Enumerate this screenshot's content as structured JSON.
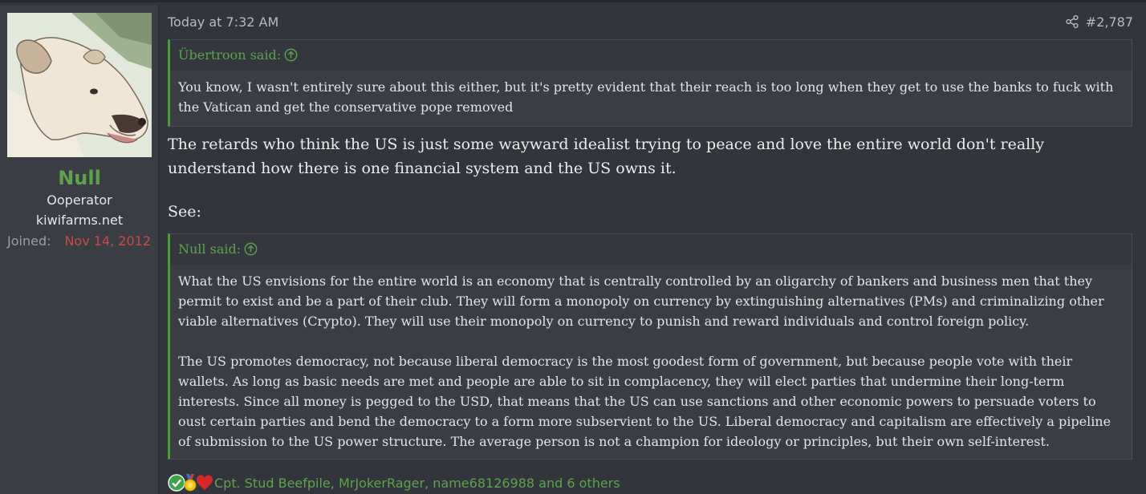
{
  "author": {
    "username": "Null",
    "title_line1": "Ooperator",
    "title_line2": "kiwifarms.net",
    "joined_label": "Joined:",
    "joined_value": "Nov 14, 2012"
  },
  "post": {
    "timestamp": "Today at 7:32 AM",
    "number": "#2,787",
    "quote1": {
      "author": "Übertroon said:",
      "text": "You know, I wasn't entirely sure about this either, but it's pretty evident that their reach is too long when they get to use the banks to fuck with the Vatican and get the conservative pope removed"
    },
    "body_text": "The retards who think the US is just some wayward idealist trying to peace and love the entire world don't really understand how there is one financial system and the US owns it.",
    "see_text": "See:",
    "quote2": {
      "author": "Null said:",
      "para1": "What the US envisions for the entire world is an economy that is centrally controlled by an oligarchy of bankers and business men that they permit to exist and be a part of their club. They will form a monopoly on currency by extinguishing alternatives (PMs) and criminalizing other viable alternatives (Crypto). They will use their monopoly on currency to punish and reward individuals and control foreign policy.",
      "para2": "The US promotes democracy, not because liberal democracy is the most goodest form of government, but because people vote with their wallets. As long as basic needs are met and people are able to sit in complacency, they will elect parties that undermine their long-term interests. Since all money is pegged to the USD, that means that the US can use sanctions and other economic powers to persuade voters to oust certain parties and bend the democracy to a form more subservient to the US. Liberal democracy and capitalism are effectively a pipeline of submission to the US power structure. The average person is not a champion for ideology or principles, but their own self-interest."
    },
    "reactions": {
      "icons": [
        "check-reaction-icon",
        "medal-reaction-icon",
        "heart-reaction-icon"
      ],
      "names_text": "Cpt. Stud Beefpile, MrJokerRager, name68126988 and 6 others"
    }
  },
  "colors": {
    "accent_green": "#5ea24e",
    "joined_red": "#c84a4a",
    "background": "#32353c"
  }
}
